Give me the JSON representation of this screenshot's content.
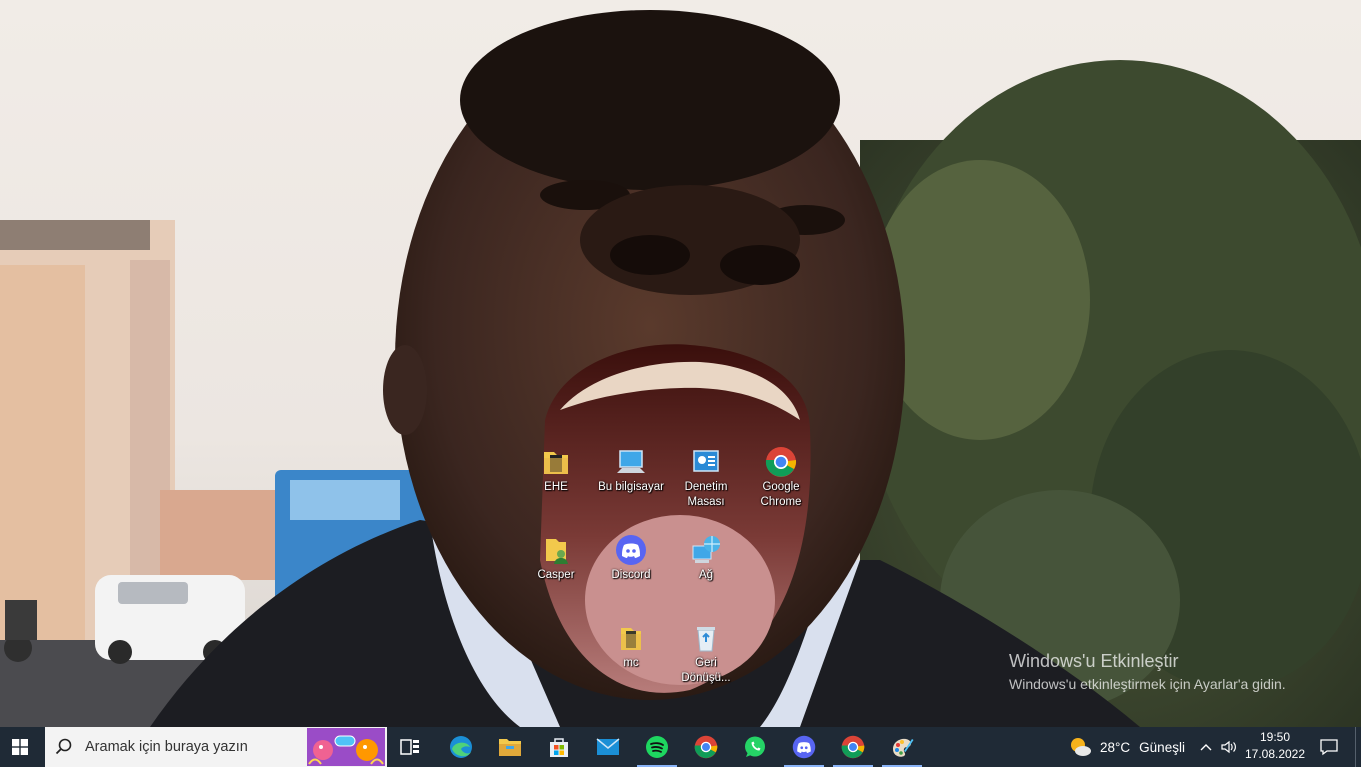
{
  "desktop": {
    "icons": [
      {
        "label": "EHE"
      },
      {
        "label": "Bu bilgisayar"
      },
      {
        "label": "Denetim Masası"
      },
      {
        "label": "Google Chrome"
      },
      {
        "label": "Casper"
      },
      {
        "label": "Discord"
      },
      {
        "label": "Ağ"
      },
      {
        "label": "mc"
      },
      {
        "label": "Geri Dönüşü..."
      }
    ]
  },
  "watermark": {
    "title": "Windows'u Etkinleştir",
    "subtitle": "Windows'u etkinleştirmek için Ayarlar'a gidin."
  },
  "taskbar": {
    "search_placeholder": "Aramak için buraya yazın",
    "apps": [
      {
        "icon": "task-view-icon",
        "running": false
      },
      {
        "icon": "edge-icon",
        "running": false
      },
      {
        "icon": "file-explorer-icon",
        "running": false
      },
      {
        "icon": "microsoft-store-icon",
        "running": false
      },
      {
        "icon": "mail-icon",
        "running": false
      },
      {
        "icon": "spotify-icon",
        "running": true
      },
      {
        "icon": "chrome-icon",
        "running": false
      },
      {
        "icon": "whatsapp-icon",
        "running": false
      },
      {
        "icon": "discord-icon",
        "running": true
      },
      {
        "icon": "chrome-icon",
        "running": true
      },
      {
        "icon": "paint-icon",
        "running": true
      }
    ],
    "weather": {
      "temp": "28°C",
      "condition": "Güneşli"
    },
    "clock": {
      "time": "19:50",
      "date": "17.08.2022"
    }
  },
  "colors": {
    "taskbar_bg": "#1f2a36",
    "accent_running": "#8ab4f8"
  }
}
